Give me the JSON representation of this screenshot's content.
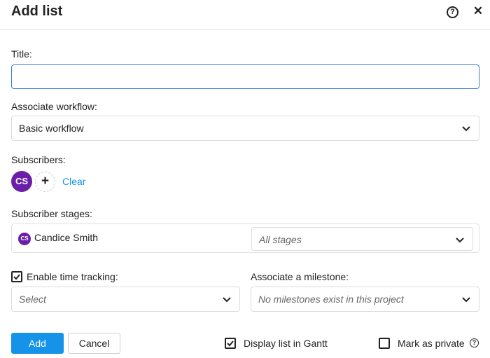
{
  "header": {
    "title": "Add list"
  },
  "title_field": {
    "label": "Title:",
    "value": "",
    "placeholder": ""
  },
  "workflow": {
    "label": "Associate workflow:",
    "selected": "Basic workflow"
  },
  "subscribers": {
    "label": "Subscribers:",
    "avatar_initials": "CS",
    "clear_label": "Clear",
    "avatar_color": "#6b1fa8"
  },
  "subscriber_stages": {
    "label": "Subscriber stages:",
    "rows": [
      {
        "initials": "CS",
        "name": "Candice Smith",
        "stage_placeholder": "All stages"
      }
    ]
  },
  "time_tracking": {
    "label": "Enable time tracking:",
    "checked": true,
    "select_placeholder": "Select"
  },
  "milestone": {
    "label": "Associate a milestone:",
    "placeholder": "No milestones exist in this project"
  },
  "footer": {
    "add_label": "Add",
    "cancel_label": "Cancel",
    "gantt_label": "Display list in Gantt",
    "gantt_checked": true,
    "private_label": "Mark as private",
    "private_checked": false
  },
  "icons": {
    "help": "help-circle-icon",
    "close": "close-icon",
    "chevron": "chevron-down-icon",
    "plus": "plus-icon",
    "check": "checkmark-icon"
  },
  "colors": {
    "accent": "#1593e8",
    "focus_border": "#3d7fd9",
    "avatar": "#6b1fa8",
    "link": "#1592e6"
  }
}
